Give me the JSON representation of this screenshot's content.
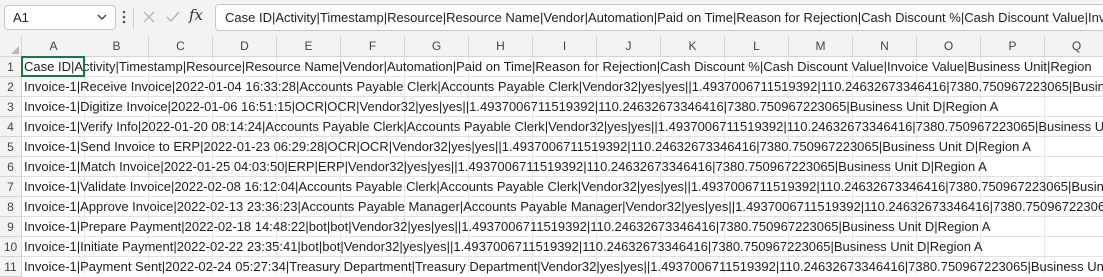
{
  "formula_bar": {
    "name_box": "A1",
    "fx_label": "fx",
    "formula": "Case ID|Activity|Timestamp|Resource|Resource Name|Vendor|Automation|Paid on Time|Reason for Rejection|Cash Discount %|Cash Discount Value|Invoice Value|Business"
  },
  "columns": [
    "A",
    "B",
    "C",
    "D",
    "E",
    "F",
    "G",
    "H",
    "I",
    "J",
    "K",
    "L",
    "M",
    "N",
    "O",
    "P",
    "Q"
  ],
  "rows": [
    {
      "num": "1",
      "text": "Case ID|Activity|Timestamp|Resource|Resource Name|Vendor|Automation|Paid on Time|Reason for Rejection|Cash Discount %|Cash Discount Value|Invoice Value|Business Unit|Region"
    },
    {
      "num": "2",
      "text": "Invoice-1|Receive Invoice|2022-01-04 16:33:28|Accounts Payable Clerk|Accounts Payable Clerk|Vendor32|yes|yes||1.4937006711519392|110.24632673346416|7380.750967223065|Business Unit D|Region A"
    },
    {
      "num": "3",
      "text": "Invoice-1|Digitize Invoice|2022-01-06 16:51:15|OCR|OCR|Vendor32|yes|yes||1.4937006711519392|110.24632673346416|7380.750967223065|Business Unit D|Region A"
    },
    {
      "num": "4",
      "text": "Invoice-1|Verify Info|2022-01-20 08:14:24|Accounts Payable Clerk|Accounts Payable Clerk|Vendor32|yes|yes||1.4937006711519392|110.24632673346416|7380.750967223065|Business Unit D|Region A"
    },
    {
      "num": "5",
      "text": "Invoice-1|Send Invoice to ERP|2022-01-23 06:29:28|OCR|OCR|Vendor32|yes|yes||1.4937006711519392|110.24632673346416|7380.750967223065|Business Unit D|Region A"
    },
    {
      "num": "6",
      "text": "Invoice-1|Match Invoice|2022-01-25 04:03:50|ERP|ERP|Vendor32|yes|yes||1.4937006711519392|110.24632673346416|7380.750967223065|Business Unit D|Region A"
    },
    {
      "num": "7",
      "text": "Invoice-1|Validate Invoice|2022-02-08 16:12:04|Accounts Payable Clerk|Accounts Payable Clerk|Vendor32|yes|yes||1.4937006711519392|110.24632673346416|7380.750967223065|Business Unit D|Region A"
    },
    {
      "num": "8",
      "text": "Invoice-1|Approve Invoice|2022-02-13 23:36:23|Accounts Payable Manager|Accounts Payable Manager|Vendor32|yes|yes||1.4937006711519392|110.24632673346416|7380.750967223065|Business Unit D|Region A"
    },
    {
      "num": "9",
      "text": "Invoice-1|Prepare Payment|2022-02-18 14:48:22|bot|bot|Vendor32|yes|yes||1.4937006711519392|110.24632673346416|7380.750967223065|Business Unit D|Region A"
    },
    {
      "num": "10",
      "text": "Invoice-1|Initiate Payment|2022-02-22 23:35:41|bot|bot|Vendor32|yes|yes||1.4937006711519392|110.24632673346416|7380.750967223065|Business Unit D|Region A"
    },
    {
      "num": "11",
      "text": "Invoice-1|Payment Sent|2022-02-24 05:27:34|Treasury Department|Treasury Department|Vendor32|yes|yes||1.4937006711519392|110.24632673346416|7380.750967223065|Business Unit D|Region A"
    }
  ]
}
